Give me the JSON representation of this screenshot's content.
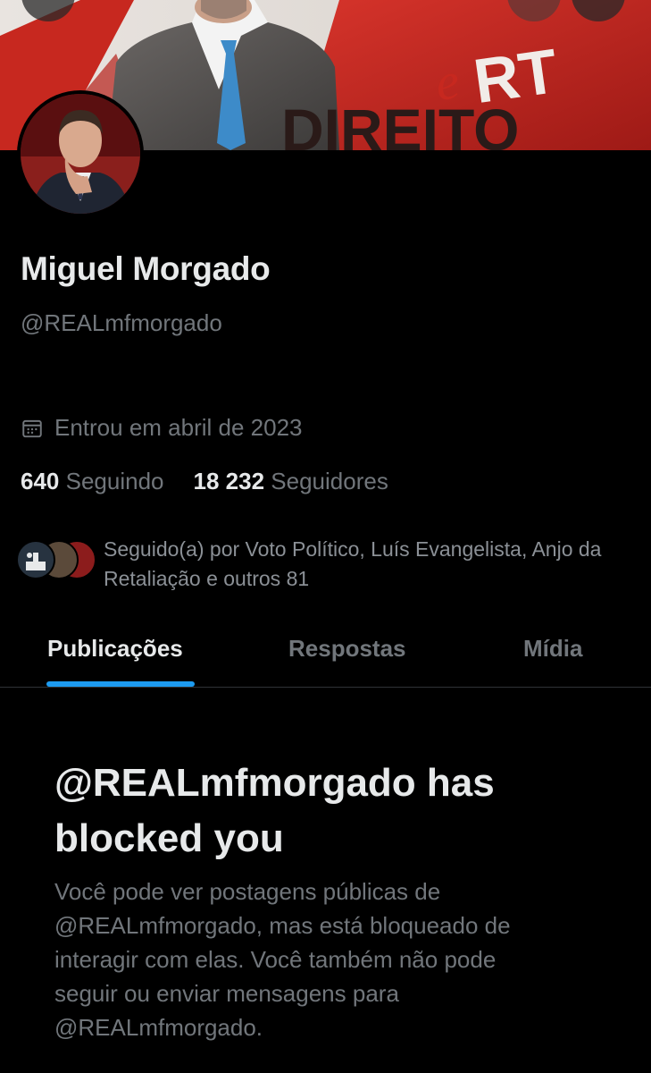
{
  "banner": {
    "text_main": "DIREITO",
    "text_logo": "eRT"
  },
  "profile": {
    "name": "Miguel Morgado",
    "handle": "@REALmfmorgado",
    "joined": "Entrou em abril de 2023",
    "following_count": "640",
    "following_label": "Seguindo",
    "followers_count": "18 232",
    "followers_label": "Seguidores",
    "followed_by": "Seguido(a) por Voto Político, Luís Evangelista, Anjo da Retaliação e outros 81"
  },
  "tabs": [
    {
      "label": "Publicações",
      "active": true
    },
    {
      "label": "Respostas",
      "active": false
    },
    {
      "label": "Mídia",
      "active": false
    }
  ],
  "blocked": {
    "title": "@REALmfmorgado has blocked you",
    "description": "Você pode ver postagens públicas de @REALmfmorgado, mas está bloqueado de interagir com elas. Você também não pode seguir ou enviar mensagens para @REALmfmorgado."
  },
  "colors": {
    "background": "#000000",
    "text_primary": "#e7e9ea",
    "text_secondary": "#71767b",
    "accent": "#1d9bf0",
    "divider": "#2f3336"
  },
  "icons": {
    "joined": "calendar-icon"
  }
}
